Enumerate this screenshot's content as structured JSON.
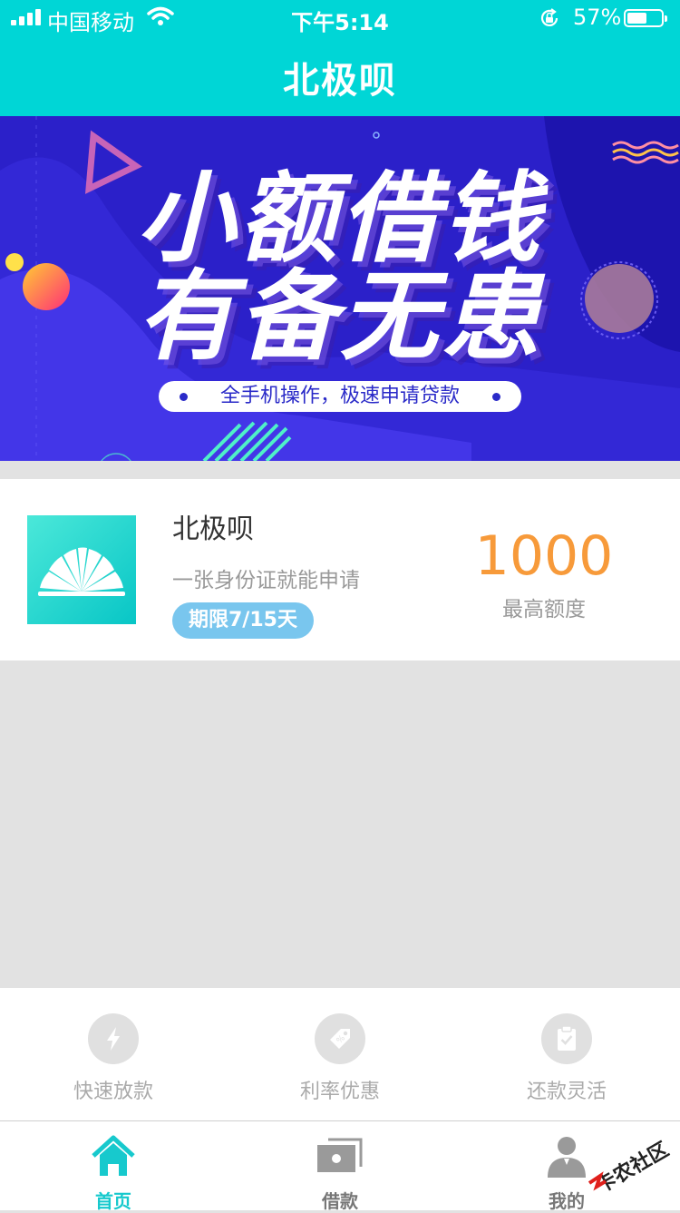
{
  "status": {
    "carrier": "中国移动",
    "time": "下午5:14",
    "battery": "57%",
    "battery_level": 0.57
  },
  "header": {
    "title": "北极呗"
  },
  "banner": {
    "line1": "小额借钱",
    "line2": "有备无患",
    "slogan": "全手机操作，极速申请贷款"
  },
  "product": {
    "name": "北极呗",
    "desc": "一张身份证就能申请",
    "tag": "期限7/15天",
    "amount": "1000",
    "amount_label": "最高额度"
  },
  "features": [
    {
      "label": "快速放款",
      "icon": "lightning-icon"
    },
    {
      "label": "利率优惠",
      "icon": "tag-icon"
    },
    {
      "label": "还款灵活",
      "icon": "clipboard-check-icon"
    }
  ],
  "tabs": [
    {
      "label": "首页",
      "icon": "home-icon",
      "active": true
    },
    {
      "label": "借款",
      "icon": "cash-icon",
      "active": false
    },
    {
      "label": "我的",
      "icon": "user-icon",
      "active": false
    }
  ],
  "watermark": {
    "text": "卡农社区"
  },
  "colors": {
    "brand": "#00d6d6",
    "banner_bg": "#2b20c9",
    "amount": "#f79a3a",
    "tag_bg": "#79c6ee",
    "tab_active": "#17c9cd",
    "tab_inactive": "#777777"
  }
}
